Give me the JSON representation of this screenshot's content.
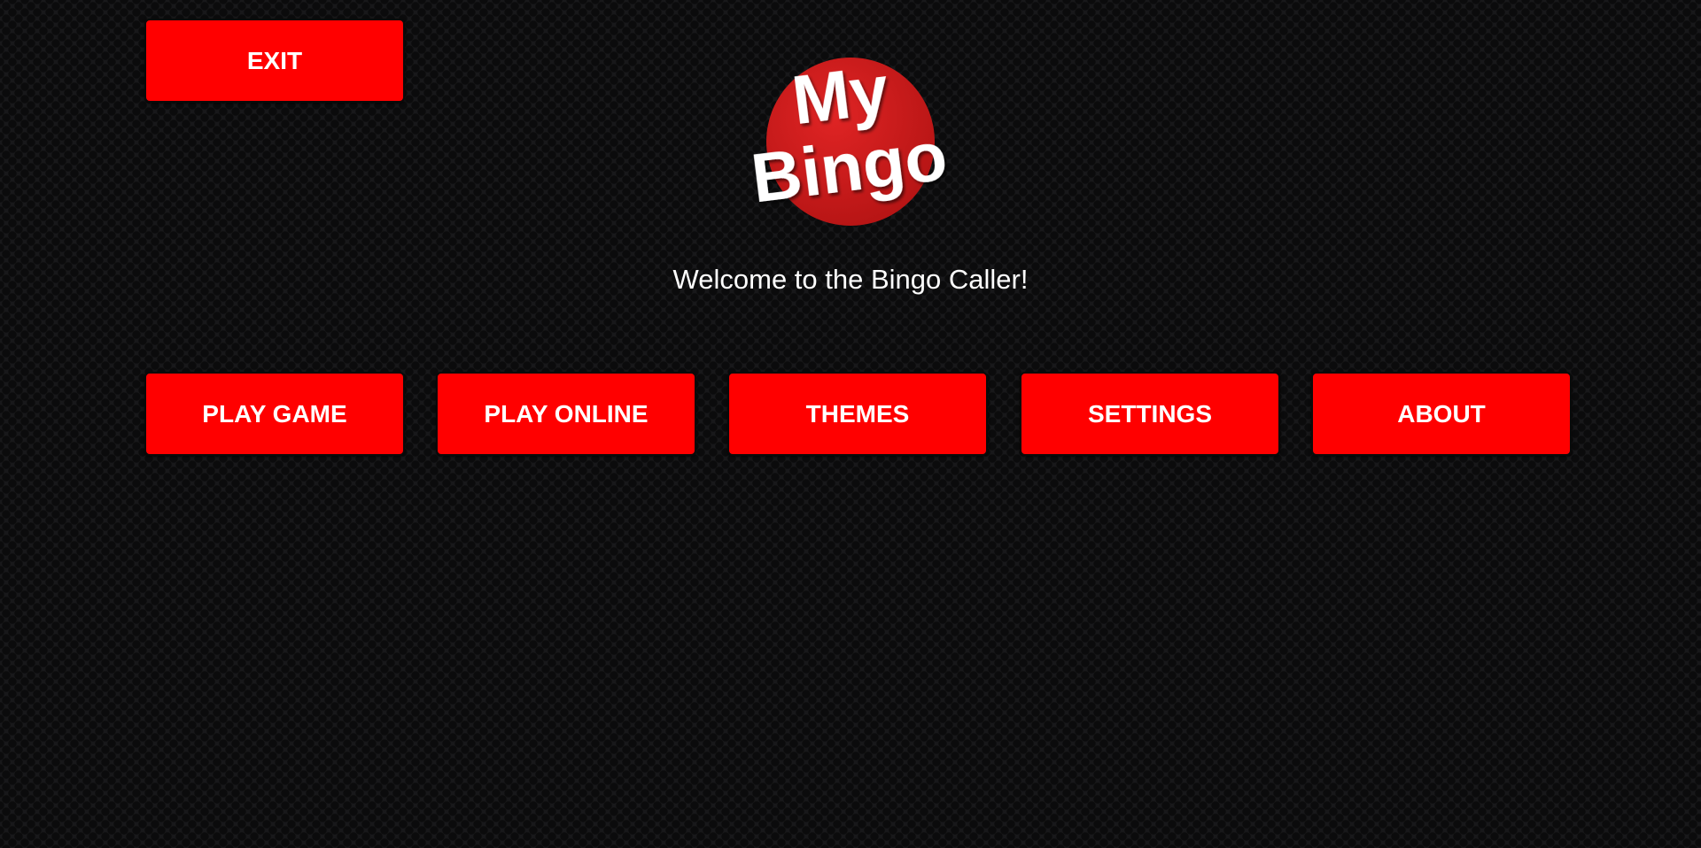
{
  "header": {
    "exit_label": "EXIT"
  },
  "logo": {
    "line1": "My",
    "line2": "Bingo",
    "circle_color": "#d21a1a",
    "text_color": "#ffffff"
  },
  "welcome_text": "Welcome to the Bingo Caller!",
  "menu": {
    "play_game_label": "PLAY GAME",
    "play_online_label": "PLAY ONLINE",
    "themes_label": "THEMES",
    "settings_label": "SETTINGS",
    "about_label": "ABOUT"
  },
  "colors": {
    "button": "#ff0000",
    "background": "#18181a",
    "text": "#ffffff"
  }
}
